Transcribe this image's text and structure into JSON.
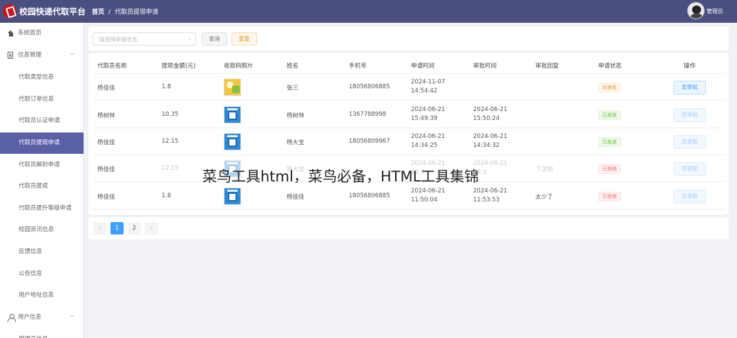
{
  "header": {
    "app_title": "校园快递代取平台",
    "breadcrumb_home": "首页",
    "breadcrumb_sep": "/",
    "breadcrumb_current": "代取员提现申请",
    "user_name": "管理员"
  },
  "sidebar": {
    "group_home": "系统首页",
    "group_info": "信息管理",
    "group_user": "用户信息",
    "expand_arrow": "^",
    "items": [
      {
        "label": "代取类型信息"
      },
      {
        "label": "代取订单信息"
      },
      {
        "label": "代取员认证申请"
      },
      {
        "label": "代取员提现申请"
      },
      {
        "label": "代取员解封申请"
      },
      {
        "label": "代取员提成"
      },
      {
        "label": "代取员提升等级申请"
      },
      {
        "label": "校园资讯信息"
      },
      {
        "label": "反馈信息"
      },
      {
        "label": "公告信息"
      },
      {
        "label": "用户地址信息"
      }
    ],
    "partial_item": "管理员信息"
  },
  "filter": {
    "status_placeholder": "请选择申请状态",
    "query_label": "查询",
    "reset_label": "重置"
  },
  "table": {
    "columns": [
      "代取员名称",
      "提现金额(元)",
      "收款码照片",
      "姓名",
      "手机号",
      "申请时间",
      "审批时间",
      "审批回复",
      "申请状态",
      "操作"
    ],
    "rows": [
      {
        "agent": "杨佳佳",
        "amount": "1.8",
        "photo": "photo",
        "name": "张三",
        "phone": "18056806885",
        "apply_date": "2024-11-07",
        "apply_time": "14:54:42",
        "approve_date": "",
        "approve_time": "",
        "reply": "",
        "status": "待审批",
        "status_type": "wait",
        "action": "去审批",
        "action_enabled": true
      },
      {
        "agent": "杨树林",
        "amount": "10.35",
        "photo": "qr",
        "name": "杨树林",
        "phone": "1367788998",
        "apply_date": "2024-06-21",
        "apply_time": "15:49:39",
        "approve_date": "2024-06-21",
        "approve_time": "15:50:24",
        "reply": "",
        "status": "已发放",
        "status_type": "done",
        "action": "去审批",
        "action_enabled": false
      },
      {
        "agent": "杨佳佳",
        "amount": "12.15",
        "photo": "qr",
        "name": "杨大宝",
        "phone": "18056809967",
        "apply_date": "2024-06-21",
        "apply_time": "14:34:25",
        "approve_date": "2024-06-21",
        "approve_time": "14:34:32",
        "reply": "",
        "status": "已发放",
        "status_type": "done",
        "action": "去审批",
        "action_enabled": false
      },
      {
        "agent": "杨佳佳",
        "amount": "12.15",
        "photo": "qr",
        "name": "杨大宝",
        "phone": "",
        "apply_date": "2024-06-21",
        "apply_time": "14:3",
        "approve_date": "2024-06-21",
        "approve_time": "14:3",
        "reply": "下次吧",
        "status": "已拒绝",
        "status_type": "rej",
        "action": "去审批",
        "action_enabled": false,
        "dim": true
      },
      {
        "agent": "杨佳佳",
        "amount": "1.8",
        "photo": "qr",
        "name": "杨佳佳",
        "phone": "18056806885",
        "apply_date": "2024-06-21",
        "apply_time": "11:50:04",
        "approve_date": "2024-06-21",
        "approve_time": "11:53:53",
        "reply": "太少了",
        "status": "已拒绝",
        "status_type": "rej",
        "action": "去审批",
        "action_enabled": false
      }
    ]
  },
  "pagination": {
    "prev": "‹",
    "pages": [
      "1",
      "2"
    ],
    "current": "1",
    "next": "›"
  },
  "watermark": "菜鸟工具html，菜鸟必备，HTML工具集锦"
}
